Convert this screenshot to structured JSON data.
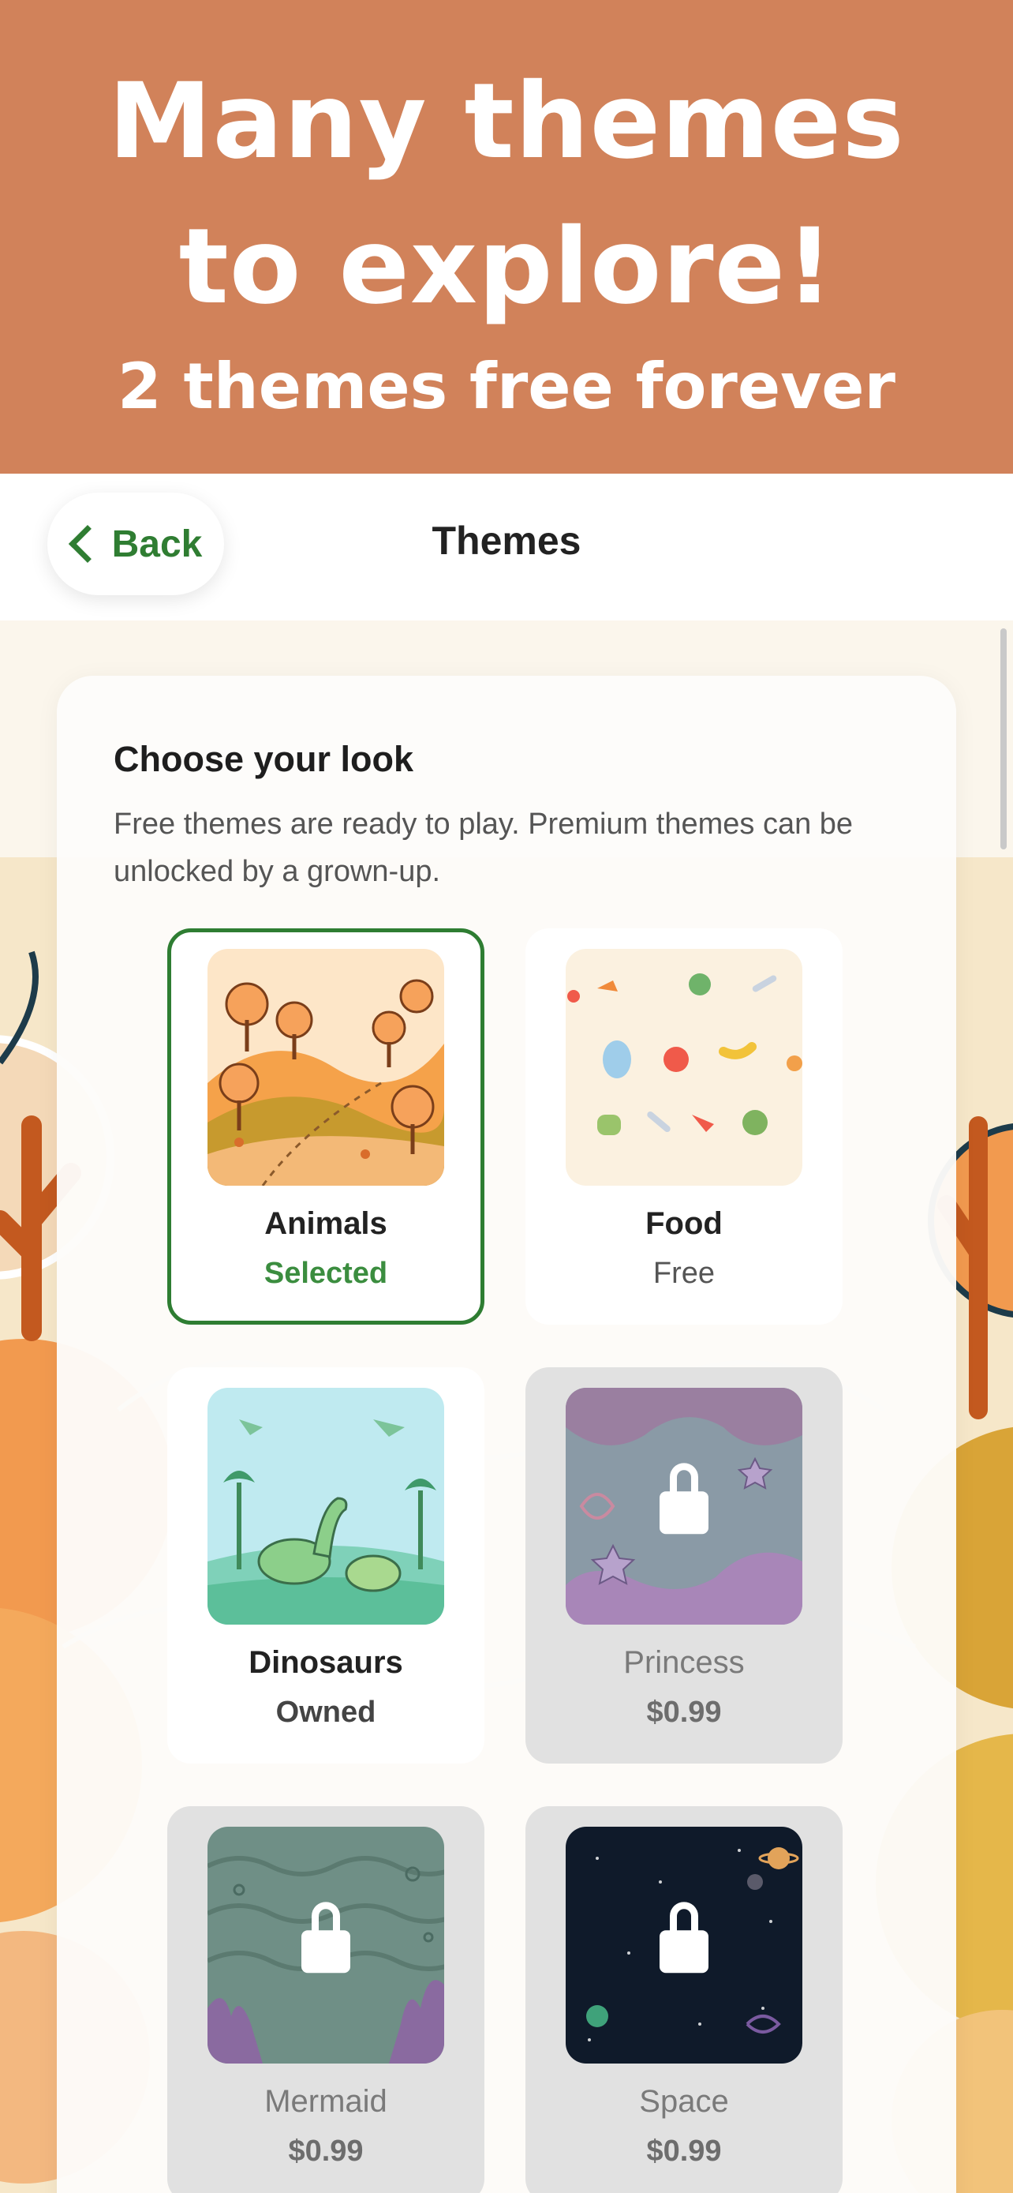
{
  "banner": {
    "title": "Many themes to explore!",
    "subtitle": "2 themes free forever",
    "background": "#d1825a"
  },
  "nav": {
    "back_label": "Back",
    "back_icon": "chevron-left-icon",
    "title": "Themes",
    "accent": "#2f7d32"
  },
  "panel": {
    "heading": "Choose your look",
    "description": "Free themes are ready to play. Premium themes can be unlocked by a grown-up."
  },
  "themes": [
    {
      "name": "Animals",
      "status": "Selected",
      "state": "selected"
    },
    {
      "name": "Food",
      "status": "Free",
      "state": "free"
    },
    {
      "name": "Dinosaurs",
      "status": "Owned",
      "state": "owned"
    },
    {
      "name": "Princess",
      "status": "$0.99",
      "state": "locked"
    },
    {
      "name": "Mermaid",
      "status": "$0.99",
      "state": "locked"
    },
    {
      "name": "Space",
      "status": "$0.99",
      "state": "locked"
    }
  ],
  "colors": {
    "selected_border": "#2e7d32",
    "locked_card": "#e1e1e1"
  }
}
